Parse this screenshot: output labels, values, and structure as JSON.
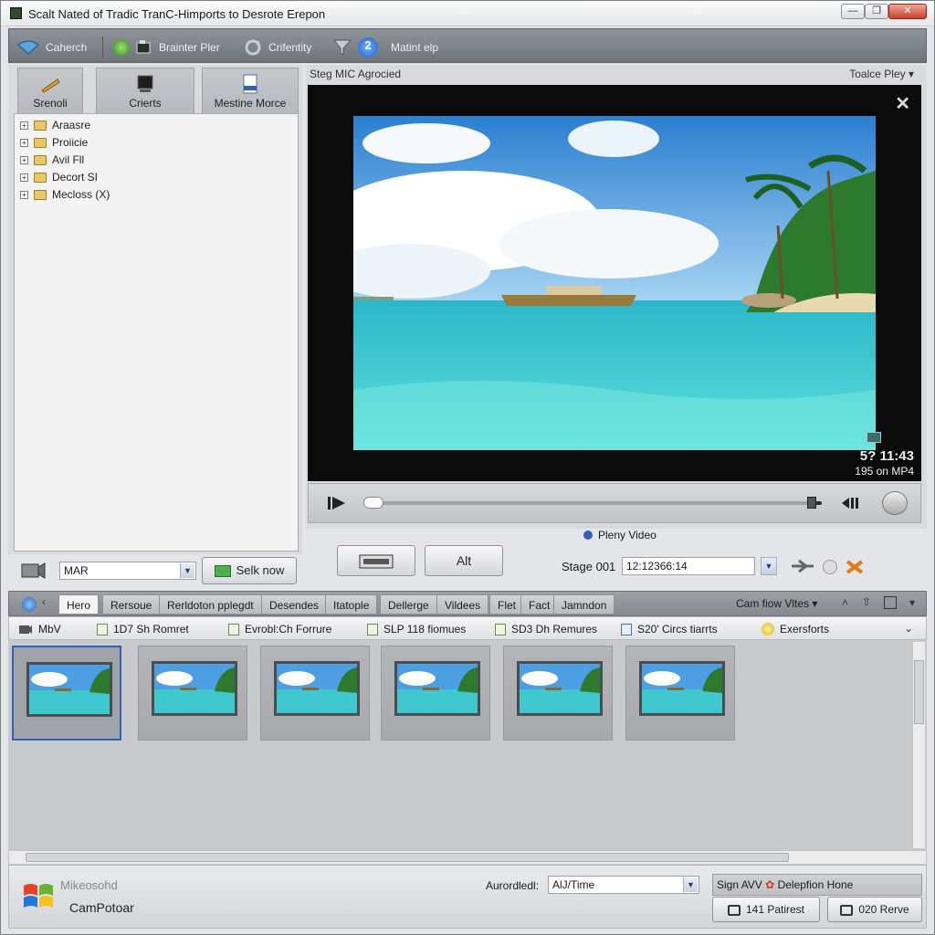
{
  "window": {
    "title": "Scalt Nated of Tradic TranC-Himports to Desrote Erepon",
    "minimize_glyph": "—",
    "restore_glyph": "❐",
    "close_glyph": "✕"
  },
  "toolbar": {
    "items": [
      {
        "label": "Caherch",
        "icon": "wifi-icon"
      },
      {
        "label": "Brainter Pler",
        "icon": "record-icon"
      },
      {
        "label": "Crifentity",
        "icon": "refresh-icon"
      },
      {
        "label": "Matint elp",
        "icon": "help-icon"
      }
    ],
    "help_badge": "2"
  },
  "left_tabs": [
    {
      "label": "Srenoli",
      "icon": "pencil-icon"
    },
    {
      "label": "Crierts",
      "icon": "monitor-icon"
    },
    {
      "label": "Mestine Morce",
      "icon": "document-icon"
    }
  ],
  "tree": [
    {
      "label": "Araasre"
    },
    {
      "label": "Proiicie"
    },
    {
      "label": "Avil Fll"
    },
    {
      "label": "Decort SI"
    },
    {
      "label": "Mecloss (X)"
    }
  ],
  "left_footer": {
    "field_value": "MAR",
    "button_label": "Selk now"
  },
  "viewer": {
    "title": "Steg MIC Agrocied",
    "right_menu": "Toalce Pley",
    "close_glyph": "✕",
    "time": "5? 11:43",
    "meta": "195 on MP4",
    "seek_progress": 0.98
  },
  "player_bar": {
    "status_label": "Pleny Video",
    "alt_button": "Alt",
    "stage_label": "Stage 001",
    "stage_value": "12:12366:14"
  },
  "tabs": [
    {
      "label": "Hero",
      "active": true
    },
    {
      "label": "Rersoue"
    },
    {
      "label": "Rerldoton pplegdt"
    },
    {
      "label": "Desendes"
    },
    {
      "label": "Itatople"
    },
    {
      "label": "Dellerge"
    },
    {
      "label": "Vildees"
    },
    {
      "label": "Flet"
    },
    {
      "label": "Fact"
    },
    {
      "label": "Jamndon"
    }
  ],
  "tabs_right": {
    "label": "Cam fiow Vltes"
  },
  "filters": [
    {
      "label": "MbV"
    },
    {
      "label": "1D7 Sh Romret"
    },
    {
      "label": "Evrobl:Ch Forrure"
    },
    {
      "label": "SLP 118 fiomues"
    },
    {
      "label": "SD3 Dh Remures"
    },
    {
      "label": "S20' Circs tiarrts"
    },
    {
      "label": "Exersforts"
    }
  ],
  "thumbnails_count": 6,
  "footer": {
    "brand_top": "Mikeosohd",
    "brand_bottom": "CamPotoar",
    "combo_label": "Aurordledl:",
    "combo_value": "AlJ/Time",
    "status_text": "Sign AVV",
    "status_link": "Delepfion Hone",
    "btn1": "141 Patirest",
    "btn2": "020 Rerve"
  },
  "colors": {
    "accent": "#2f5fb8",
    "toolbar": "#7e8389",
    "water": "#3cc6cf"
  }
}
